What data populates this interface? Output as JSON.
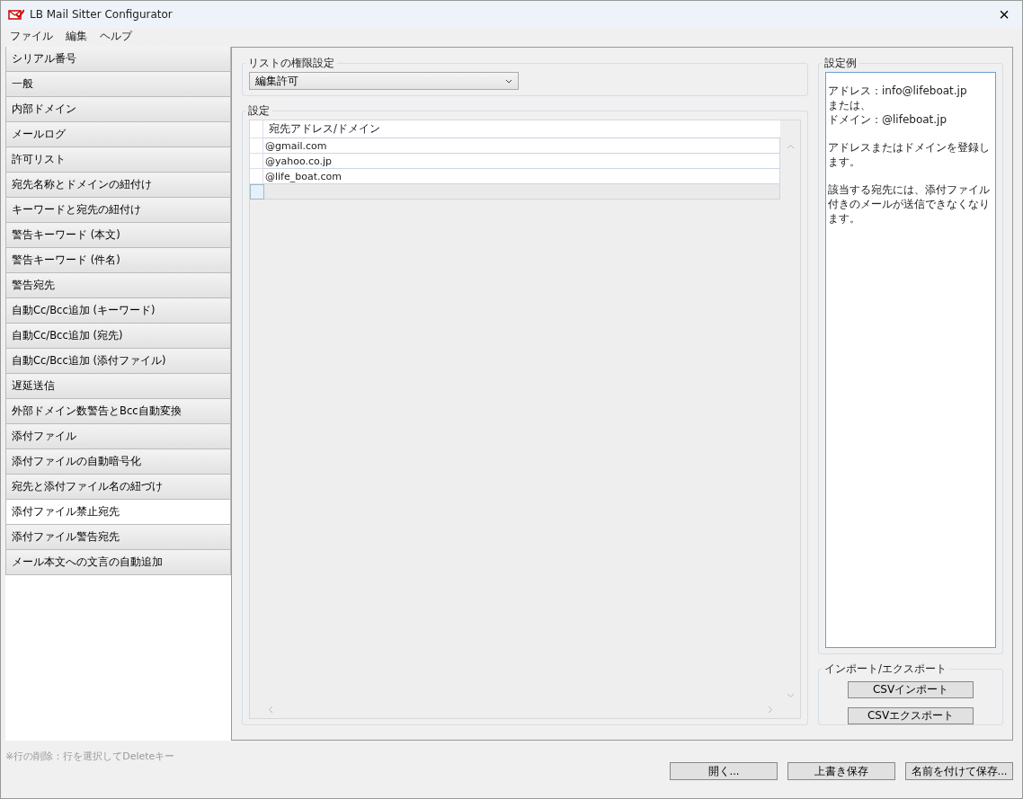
{
  "window": {
    "title": "LB Mail Sitter Configurator",
    "close": "×"
  },
  "menu": [
    "ファイル",
    "編集",
    "ヘルプ"
  ],
  "sidebar": {
    "items": [
      {
        "label": "シリアル番号",
        "selected": false
      },
      {
        "label": "一般",
        "selected": false
      },
      {
        "label": "内部ドメイン",
        "selected": false
      },
      {
        "label": "メールログ",
        "selected": false
      },
      {
        "label": "許可リスト",
        "selected": false
      },
      {
        "label": "宛先名称とドメインの紐付け",
        "selected": false
      },
      {
        "label": "キーワードと宛先の紐付け",
        "selected": false
      },
      {
        "label": "警告キーワード (本文)",
        "selected": false
      },
      {
        "label": "警告キーワード (件名)",
        "selected": false
      },
      {
        "label": "警告宛先",
        "selected": false
      },
      {
        "label": "自動Cc/Bcc追加 (キーワード)",
        "selected": false
      },
      {
        "label": "自動Cc/Bcc追加 (宛先)",
        "selected": false
      },
      {
        "label": "自動Cc/Bcc追加 (添付ファイル)",
        "selected": false
      },
      {
        "label": "遅延送信",
        "selected": false
      },
      {
        "label": "外部ドメイン数警告とBcc自動変換",
        "selected": false
      },
      {
        "label": "添付ファイル",
        "selected": false
      },
      {
        "label": "添付ファイルの自動暗号化",
        "selected": false
      },
      {
        "label": "宛先と添付ファイル名の紐づけ",
        "selected": false
      },
      {
        "label": "添付ファイル禁止宛先",
        "selected": true
      },
      {
        "label": "添付ファイル警告宛先",
        "selected": false
      },
      {
        "label": "メール本文への文言の自動追加",
        "selected": false
      }
    ]
  },
  "permission": {
    "title": "リストの権限設定",
    "value": "編集許可"
  },
  "settings": {
    "title": "設定",
    "column": "宛先アドレス/ドメイン",
    "rows": [
      "@gmail.com",
      "@yahoo.co.jp",
      "@life_boat.com"
    ]
  },
  "example": {
    "title": "設定例",
    "paragraphs": [
      [
        "アドレス：info@lifeboat.jp",
        "または、",
        "ドメイン：@lifeboat.jp"
      ],
      [
        "アドレスまたはドメインを登録します。"
      ],
      [
        "該当する宛先には、添付ファイル付きのメールが送信できなくなります。"
      ]
    ]
  },
  "import_export": {
    "title": "インポート/エクスポート",
    "buttons": [
      "CSVインポート",
      "CSVエクスポート"
    ]
  },
  "note": "※行の削除：行を選択してDeleteキー",
  "buttons": [
    "開く...",
    "上書き保存",
    "名前を付けて保存..."
  ]
}
